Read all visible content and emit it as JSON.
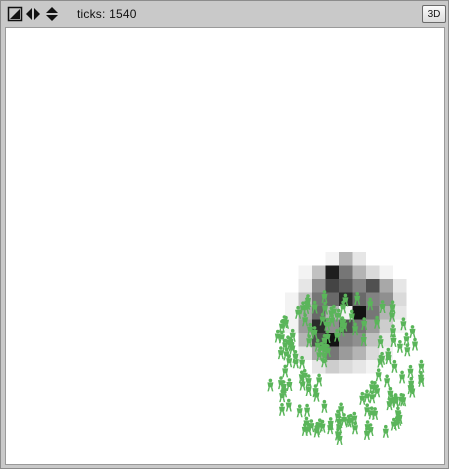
{
  "toolbar": {
    "ticks_label": "ticks:",
    "ticks_value": "1540",
    "view_3d_label": "3D",
    "icons": [
      "pan-diagonal-icon",
      "pan-horizontal-icon",
      "pan-vertical-icon"
    ]
  },
  "world": {
    "background": "#ffffff",
    "agent_color": "#5ab55a",
    "agent_shape": "person-icon",
    "patch_values": [
      [
        0,
        0,
        0,
        0.05,
        0.3,
        0.1,
        0,
        0,
        0
      ],
      [
        0,
        0.05,
        0.25,
        0.9,
        0.55,
        0.3,
        0.15,
        0.05,
        0
      ],
      [
        0,
        0.1,
        0.45,
        0.75,
        0.65,
        0.5,
        0.7,
        0.35,
        0.1
      ],
      [
        0.05,
        0.25,
        0.55,
        0.6,
        0.85,
        0.6,
        0.5,
        0.45,
        0.15
      ],
      [
        0.05,
        0.35,
        0.6,
        0.3,
        0.05,
        0.95,
        0.55,
        0.3,
        0.1
      ],
      [
        0.05,
        0.4,
        0.85,
        0.45,
        0.7,
        0.55,
        0.4,
        0.2,
        0.05
      ],
      [
        0,
        0.3,
        0.7,
        0.95,
        0.5,
        0.45,
        0.25,
        0.1,
        0
      ],
      [
        0,
        0.1,
        0.35,
        0.55,
        0.4,
        0.3,
        0.15,
        0.05,
        0
      ],
      [
        0,
        0,
        0.1,
        0.2,
        0.15,
        0.1,
        0.05,
        0,
        0
      ]
    ],
    "agent_count": 150
  }
}
